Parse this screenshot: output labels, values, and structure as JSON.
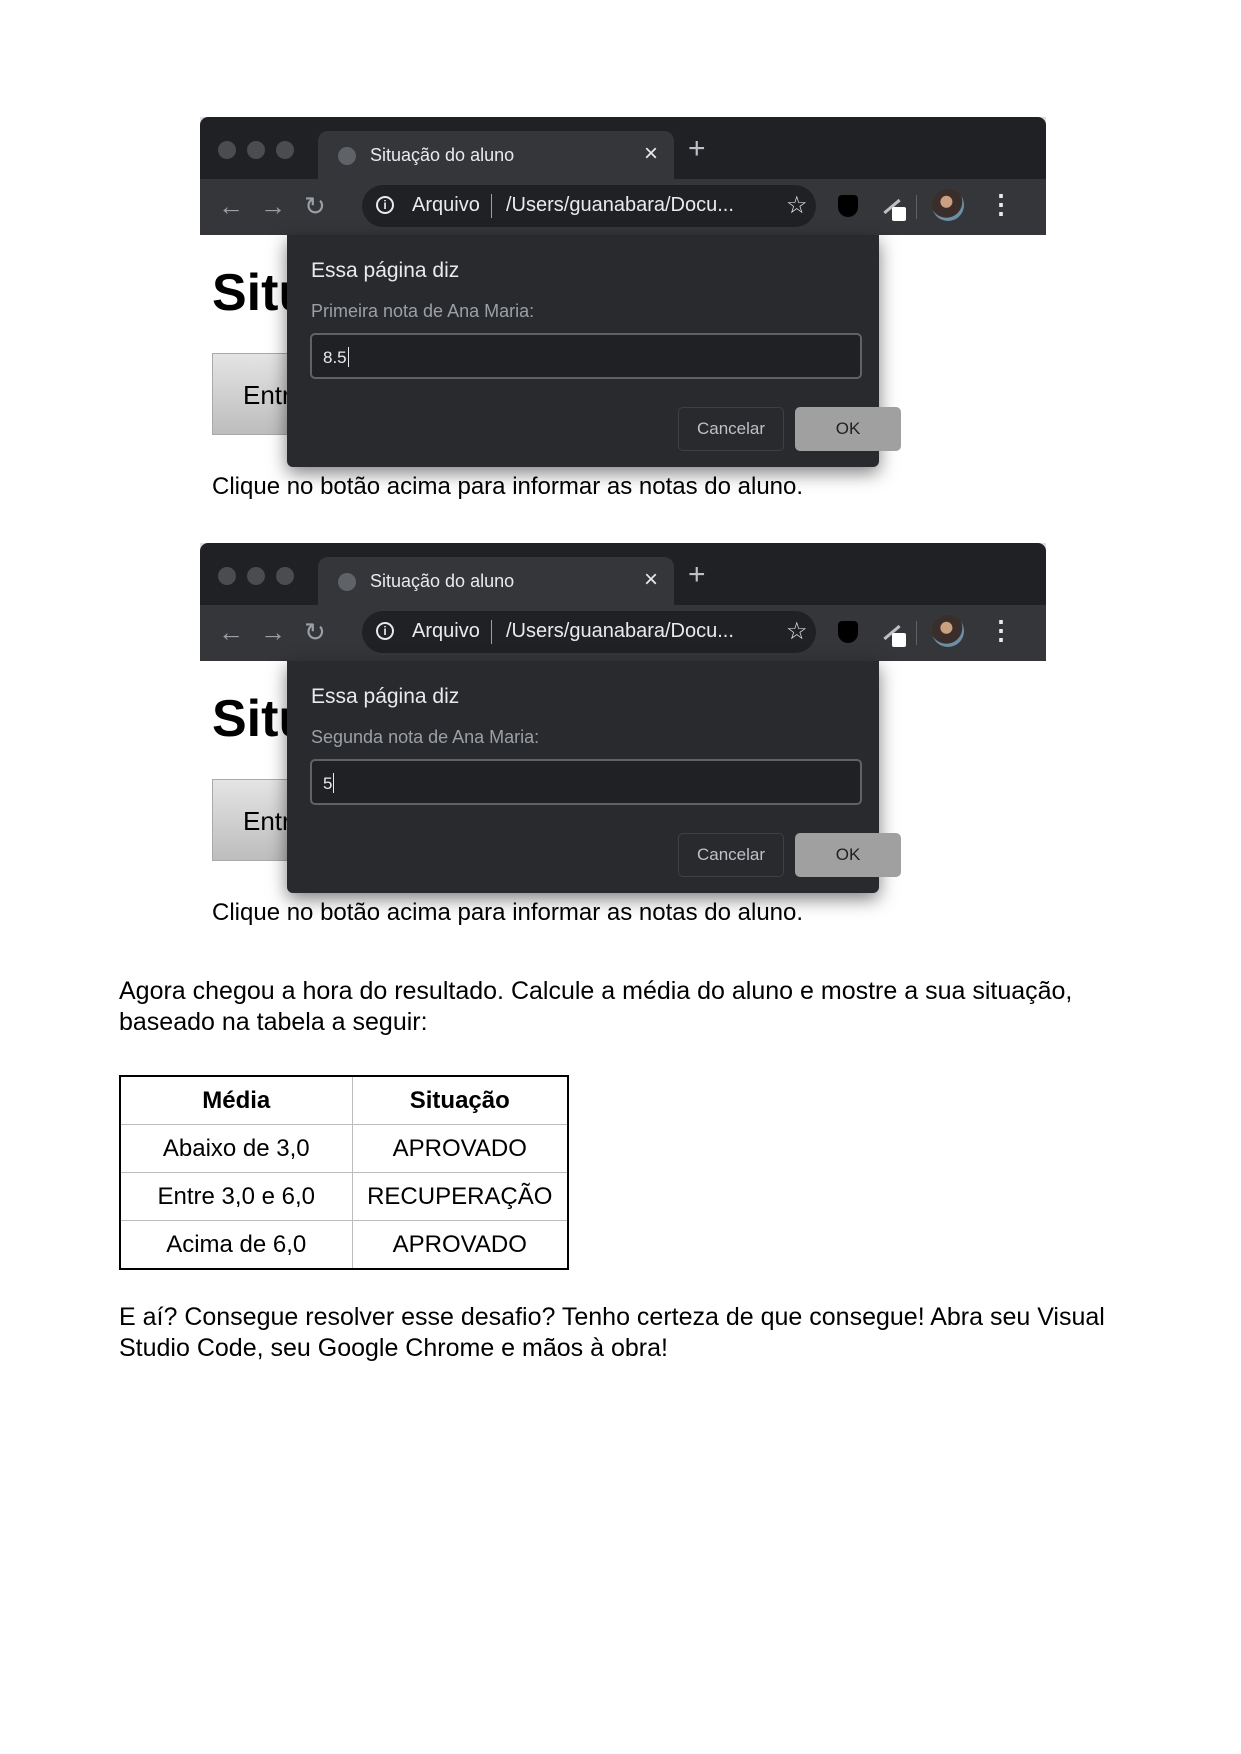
{
  "screenshots": [
    {
      "tab_title": "Situação do aluno",
      "tab_close": "×",
      "new_tab": "+",
      "nav_back": "←",
      "nav_forward": "→",
      "nav_reload": "↻",
      "omnibox_scheme": "Arquivo",
      "omnibox_url": "/Users/guanabara/Docu...",
      "bookmark_star": "☆",
      "menu": "⋮",
      "page_heading": "Situ",
      "page_button": "Entr",
      "page_hint": "Clique no botão acima para informar as notas do aluno.",
      "dialog_title": "Essa página diz",
      "dialog_message": "Primeira nota de Ana Maria:",
      "dialog_value": "8.5",
      "cancel_label": "Cancelar",
      "ok_label": "OK"
    },
    {
      "tab_title": "Situação do aluno",
      "tab_close": "×",
      "new_tab": "+",
      "nav_back": "←",
      "nav_forward": "→",
      "nav_reload": "↻",
      "omnibox_scheme": "Arquivo",
      "omnibox_url": "/Users/guanabara/Docu...",
      "bookmark_star": "☆",
      "menu": "⋮",
      "page_heading": "Situ",
      "page_button": "Entr",
      "page_hint": "Clique no botão acima para informar as notas do aluno.",
      "dialog_title": "Essa página diz",
      "dialog_message": "Segunda nota de Ana Maria:",
      "dialog_value": "5",
      "cancel_label": "Cancelar",
      "ok_label": "OK"
    }
  ],
  "intro_text": "Agora chegou a hora do resultado. Calcule a média do aluno e mostre a sua situação, baseado na tabela a seguir:",
  "table": {
    "headers": [
      "Média",
      "Situação"
    ],
    "rows": [
      [
        "Abaixo de 3,0",
        "APROVADO"
      ],
      [
        "Entre 3,0 e 6,0",
        "RECUPERAÇÃO"
      ],
      [
        "Acima de 6,0",
        "APROVADO"
      ]
    ]
  },
  "closing_text": "E aí? Consegue resolver esse desafio? Tenho certeza de que consegue! Abra seu Visual Studio Code, seu Google Chrome e mãos à obra!",
  "colors": {
    "titlebar": "#202124",
    "toolbar": "#35363a",
    "dialog": "#292a2d",
    "ok_button": "#a0a0a0"
  },
  "icons": [
    "globe-icon",
    "close-icon",
    "plus-icon",
    "back-arrow-icon",
    "forward-arrow-icon",
    "reload-icon",
    "info-icon",
    "star-icon",
    "shield-icon",
    "pen-icon",
    "avatar",
    "kebab-menu-icon"
  ]
}
